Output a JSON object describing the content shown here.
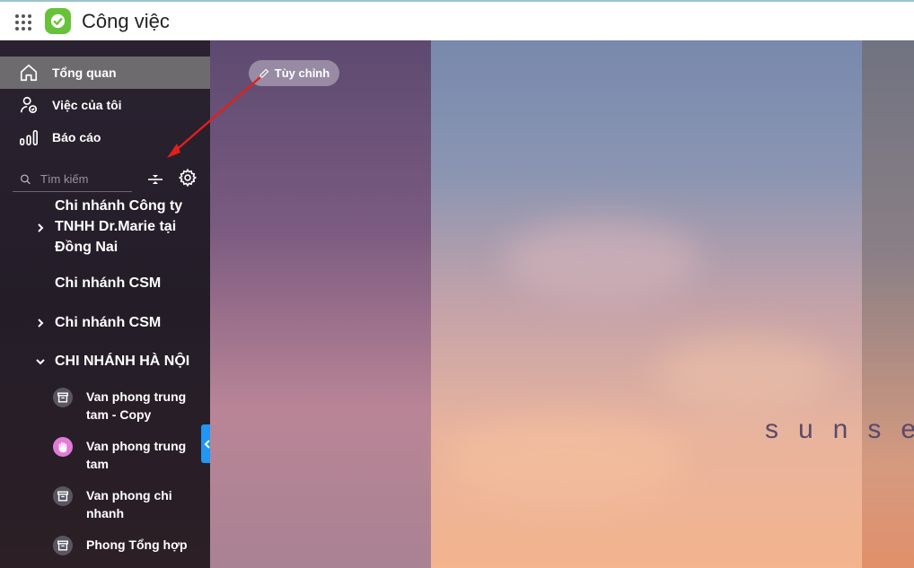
{
  "header": {
    "app_title": "Công việc",
    "apps_icon": "apps-grid-icon",
    "logo_icon": "check-logo-icon",
    "logo_color": "#67c23a"
  },
  "nav": [
    {
      "label": "Tổng quan",
      "icon": "home-icon",
      "active": true
    },
    {
      "label": "Việc của tôi",
      "icon": "user-check-icon",
      "active": false
    },
    {
      "label": "Báo cáo",
      "icon": "bar-chart-icon",
      "active": false
    }
  ],
  "search": {
    "placeholder": "Tìm kiếm"
  },
  "tree": [
    {
      "label": "Chi nhánh Công ty TNHH Dr.Marie tại Đồng Nai",
      "expanded": false,
      "has_children": true
    },
    {
      "label": "Chi nhánh CSM",
      "has_children": false
    },
    {
      "label": "Chi nhánh CSM",
      "expanded": false,
      "has_children": true
    },
    {
      "label": "CHI NHÁNH HÀ NỘI",
      "expanded": true,
      "has_children": true
    }
  ],
  "sub_items": [
    {
      "label": "Van phong trung tam - Copy",
      "icon": "archive-icon"
    },
    {
      "label": "Van phong trung tam",
      "icon": "hand-icon"
    },
    {
      "label": "Van phong chi nhanh",
      "icon": "archive-icon"
    },
    {
      "label": "Phong Tổng hợp",
      "icon": "archive-icon"
    }
  ],
  "customize_button": {
    "label": "Tùy chỉnh"
  },
  "background_text": "sunse",
  "colors": {
    "accent": "#2196f3",
    "sidebar": "#2a2230",
    "annotation_arrow": "#e0201b"
  }
}
